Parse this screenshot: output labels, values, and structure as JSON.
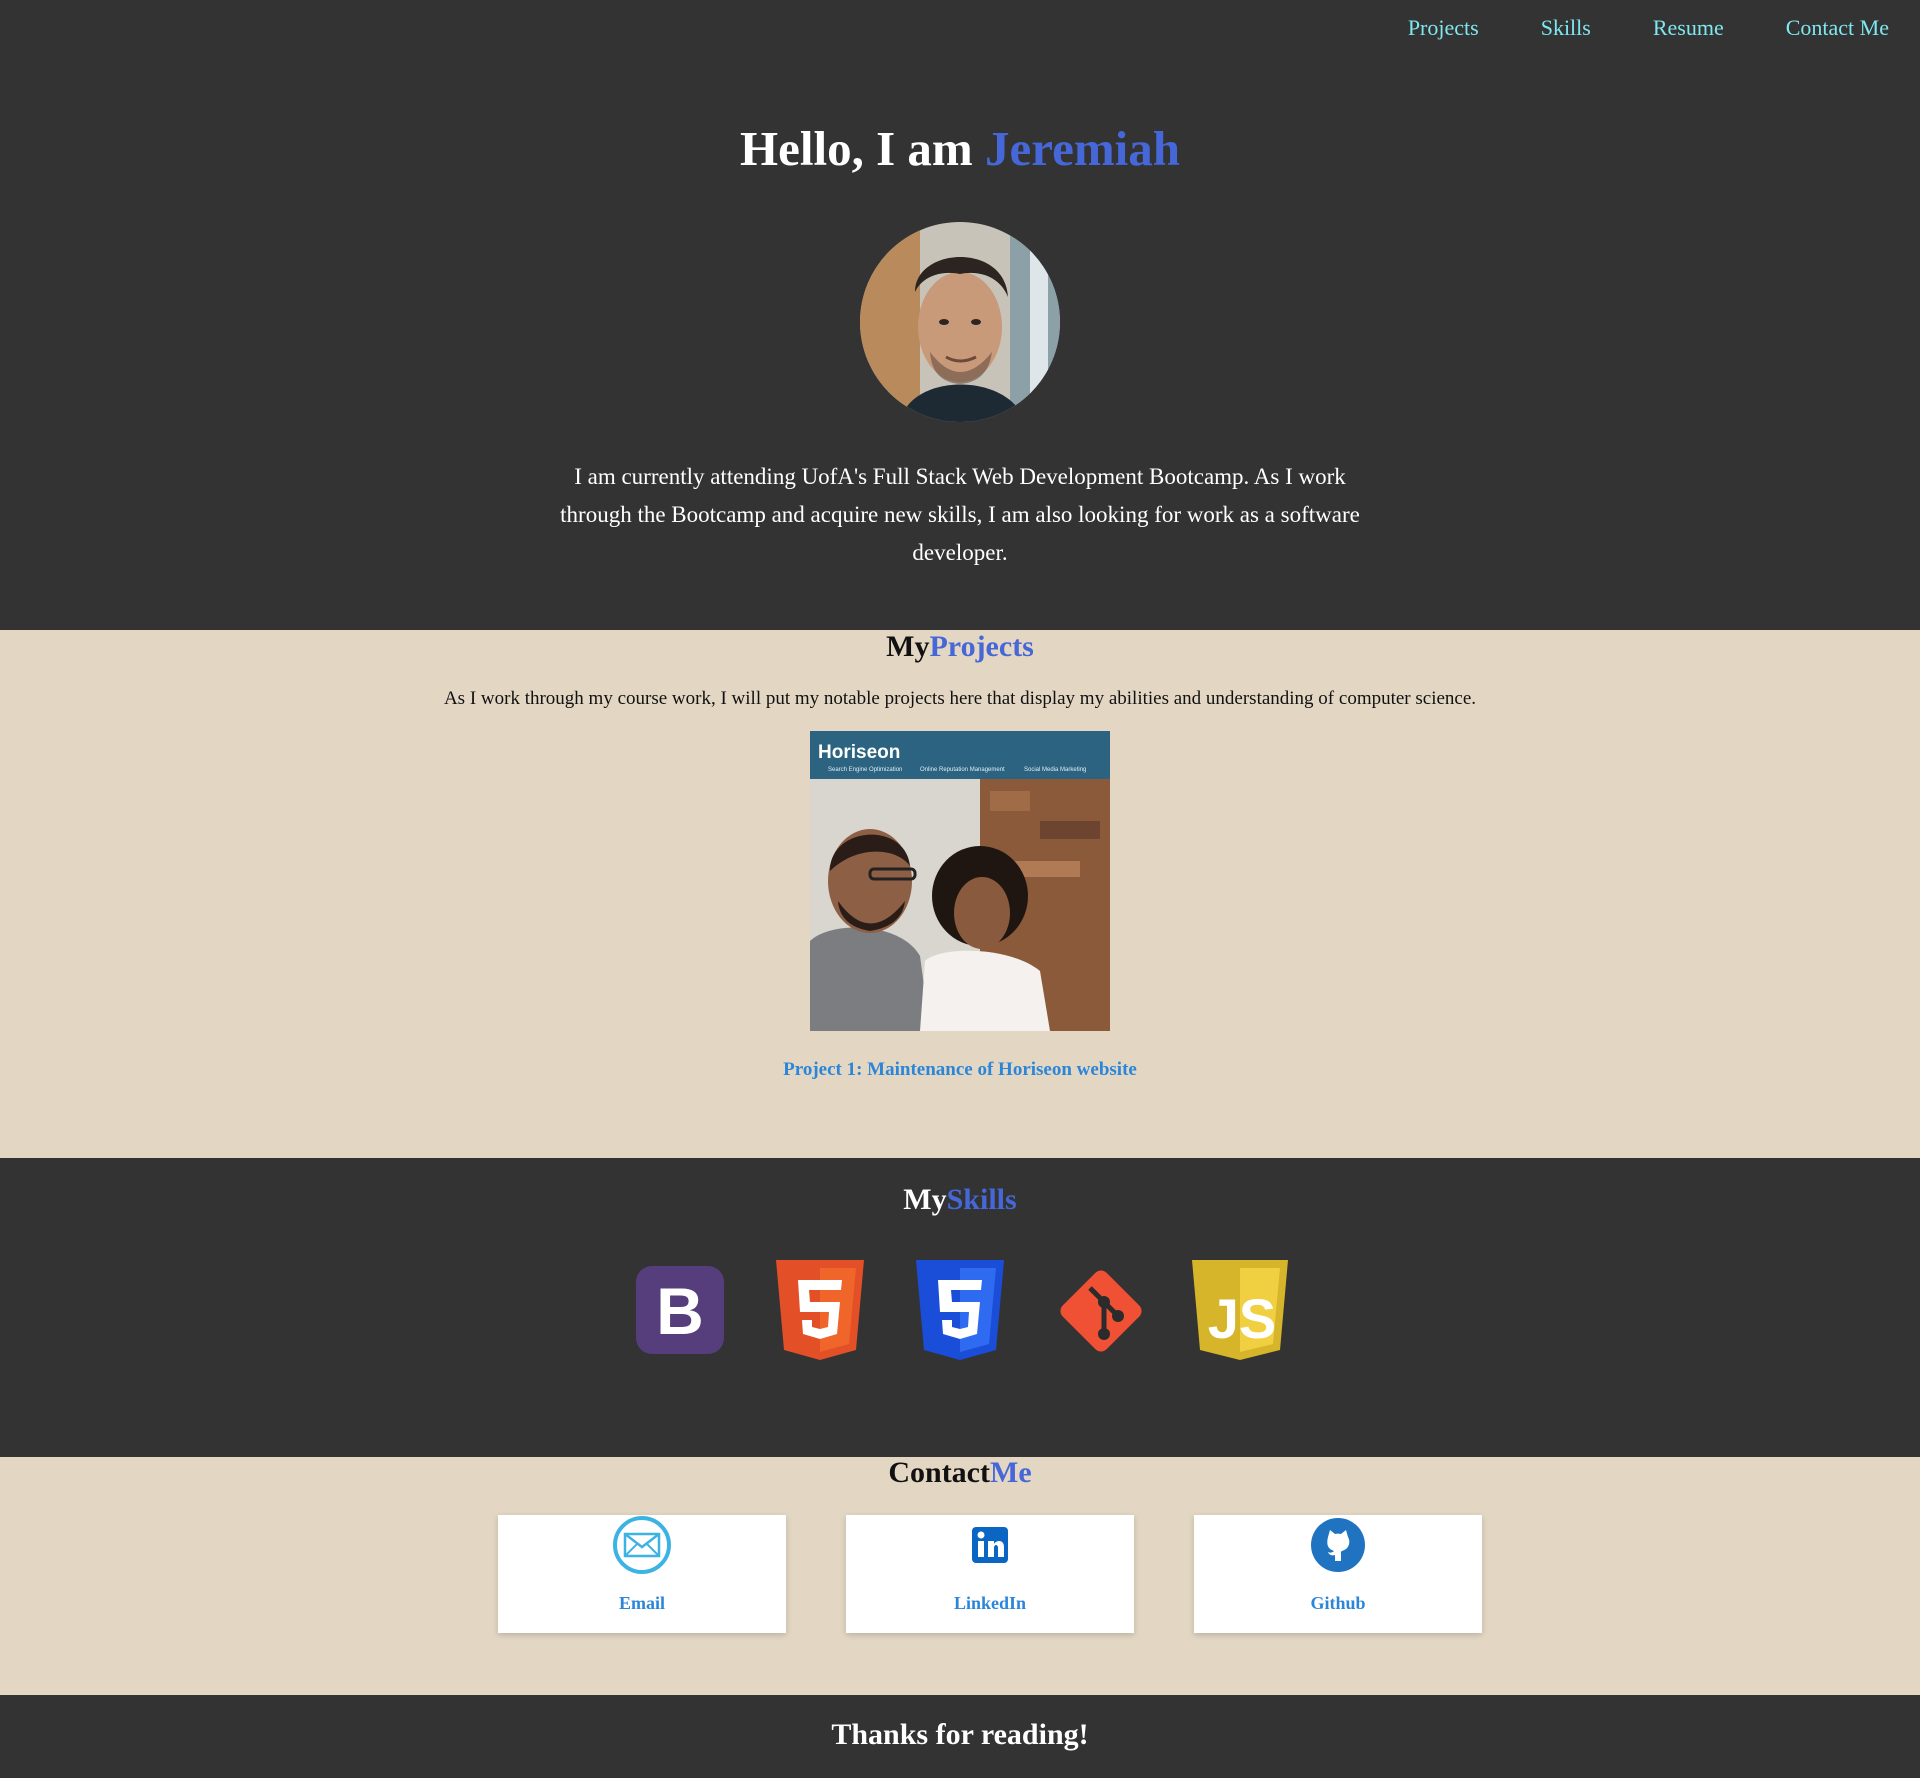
{
  "nav": {
    "items": [
      {
        "label": "Projects"
      },
      {
        "label": "Skills"
      },
      {
        "label": "Resume"
      },
      {
        "label": "Contact Me"
      }
    ]
  },
  "hero": {
    "greeting": "Hello, I am ",
    "name": "Jeremiah",
    "bio": "I am currently attending UofA's Full Stack Web Development Bootcamp. As I work through the Bootcamp and acquire new skills, I am also looking for work as a software developer."
  },
  "projects": {
    "title_prefix": "My",
    "title_accent": "Projects",
    "description": "As I work through my course work, I will put my notable projects here that display my abilities and understanding of computer science.",
    "items": [
      {
        "label": "Project 1: Maintenance of Horiseon website",
        "thumb_brand": "Horiseon",
        "thumb_tabs": [
          "Search Engine Optimization",
          "Online Reputation Management",
          "Social Media Marketing"
        ]
      }
    ]
  },
  "skills": {
    "title_prefix": "My",
    "title_accent": "Skills",
    "items": [
      "bootstrap-icon",
      "html5-icon",
      "css3-icon",
      "git-icon",
      "javascript-icon"
    ]
  },
  "contact": {
    "title_prefix": "Contact",
    "title_accent": "Me",
    "cards": [
      {
        "label": "Email",
        "icon": "email-icon"
      },
      {
        "label": "LinkedIn",
        "icon": "linkedin-icon"
      },
      {
        "label": "Github",
        "icon": "github-icon"
      }
    ]
  },
  "footer": {
    "text": "Thanks for reading!"
  },
  "colors": {
    "dark_bg": "#333333",
    "light_bg": "#e3d7c4",
    "accent": "#4567d8",
    "nav_link": "#7ee8ef",
    "link": "#2b86d9"
  }
}
